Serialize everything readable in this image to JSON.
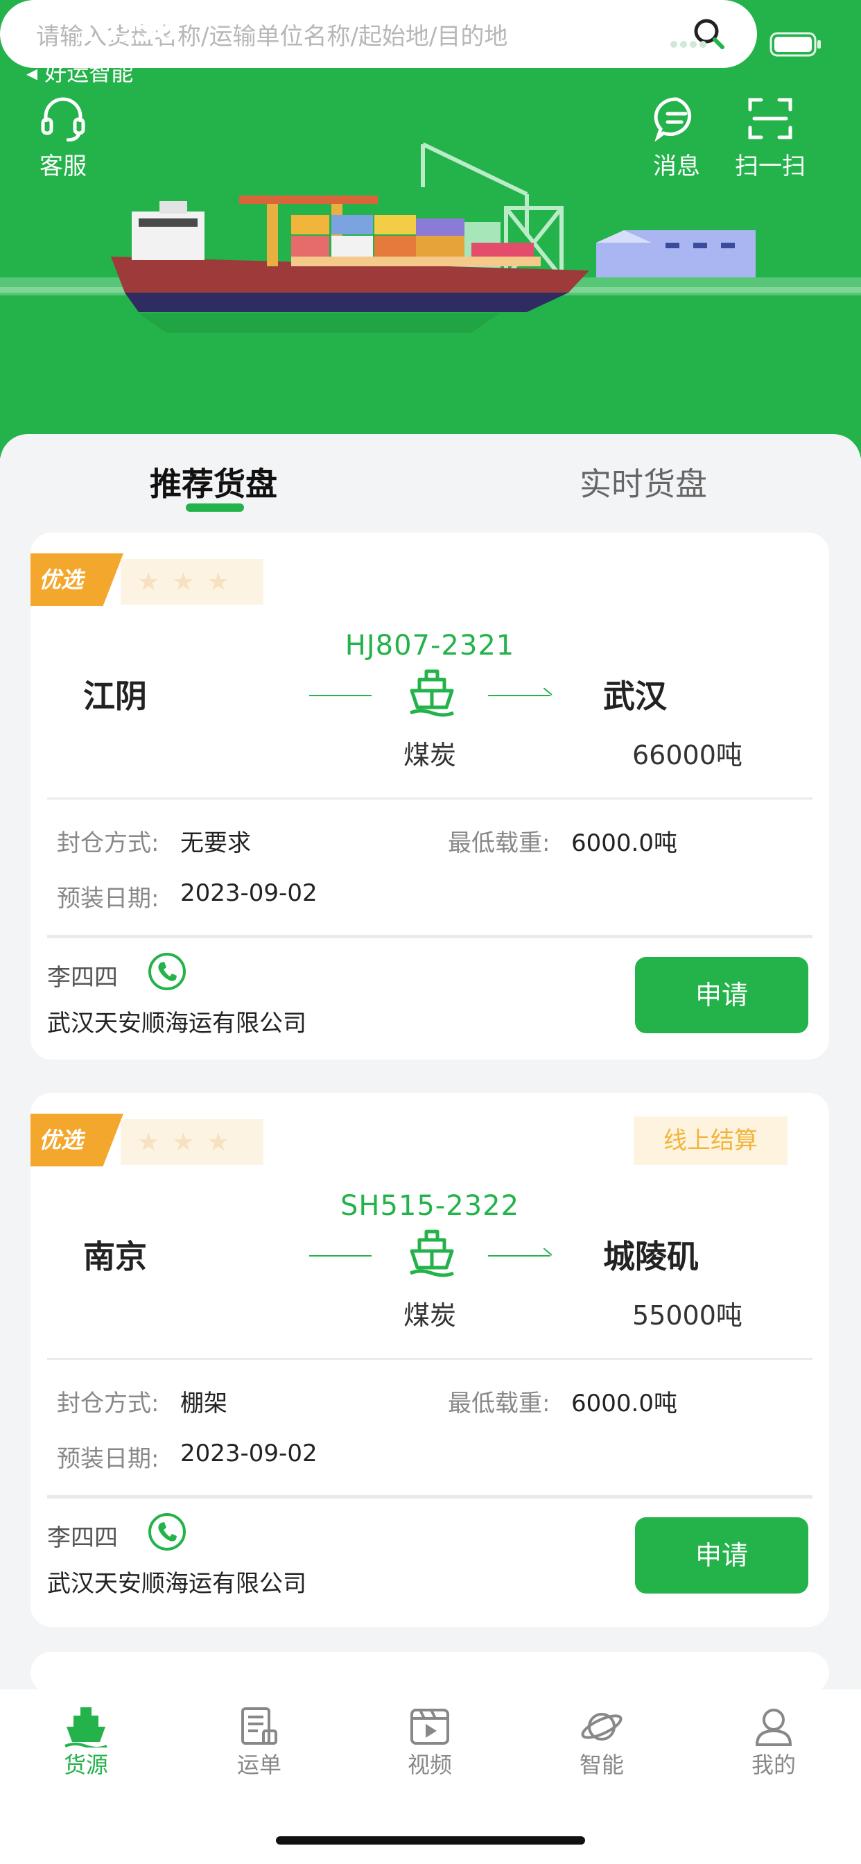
{
  "status_bar": {
    "time": "10:56",
    "back_app": "◂ 好运智能"
  },
  "header": {
    "service_label": "客服",
    "message_label": "消息",
    "scan_label": "扫一扫"
  },
  "search": {
    "placeholder": "请输入货盘名称/运输单位名称/起始地/目的地"
  },
  "tabs": {
    "recommended": "推荐货盘",
    "realtime": "实时货盘"
  },
  "cards": [
    {
      "badge": "优选",
      "settlement_tag": "",
      "code": "HJ807-2321",
      "origin": "江阴",
      "destination": "武汉",
      "cargo": "煤炭",
      "tonnage": "66000吨",
      "seal_label": "封仓方式:",
      "seal_value": "无要求",
      "min_load_label": "最低载重:",
      "min_load_value": "6000.0吨",
      "date_label": "预装日期:",
      "date_value": "2023-09-02",
      "contact": "李四四",
      "company": "武汉天安顺海运有限公司",
      "apply": "申请"
    },
    {
      "badge": "优选",
      "settlement_tag": "线上结算",
      "code": "SH515-2322",
      "origin": "南京",
      "destination": "城陵矶",
      "cargo": "煤炭",
      "tonnage": "55000吨",
      "seal_label": "封仓方式:",
      "seal_value": "棚架",
      "min_load_label": "最低载重:",
      "min_load_value": "6000.0吨",
      "date_label": "预装日期:",
      "date_value": "2023-09-02",
      "contact": "李四四",
      "company": "武汉天安顺海运有限公司",
      "apply": "申请"
    }
  ],
  "bottom_nav": [
    {
      "label": "货源",
      "icon": "ship-icon",
      "active": true
    },
    {
      "label": "运单",
      "icon": "waybill-icon",
      "active": false
    },
    {
      "label": "视频",
      "icon": "video-icon",
      "active": false
    },
    {
      "label": "智能",
      "icon": "planet-icon",
      "active": false
    },
    {
      "label": "我的",
      "icon": "user-icon",
      "active": false
    }
  ],
  "colors": {
    "brand": "#24b24a",
    "badge": "#f3a72c",
    "tag_text": "#f3b43b"
  }
}
